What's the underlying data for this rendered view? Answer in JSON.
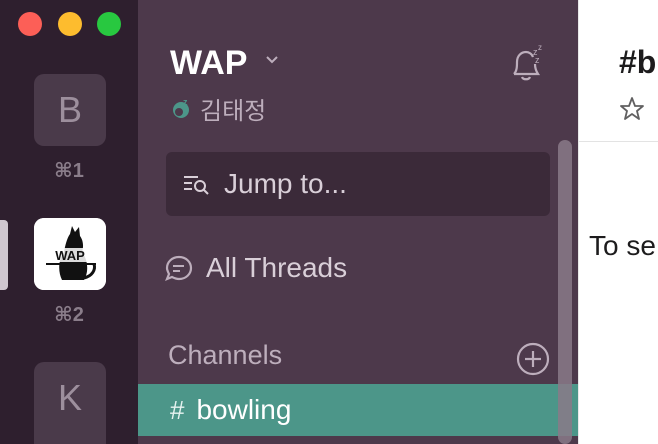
{
  "colors": {
    "rail_bg": "#2e1f2e",
    "sidebar_bg": "#4d394b",
    "active_channel_bg": "#4c9689",
    "jump_bg": "#3b2a39",
    "presence": "#4c9689"
  },
  "window_controls": [
    "close",
    "minimize",
    "zoom"
  ],
  "workspaces": [
    {
      "initial": "B",
      "shortcut": "⌘1"
    },
    {
      "logo_text": "WAP",
      "shortcut": "⌘2",
      "active": true
    },
    {
      "initial": "K"
    }
  ],
  "sidebar": {
    "team_name": "WAP",
    "user_name": "김태정",
    "jump_label": "Jump to...",
    "all_threads_label": "All Threads",
    "channels_header": "Channels",
    "channels": [
      {
        "name": "bowling",
        "active": true
      }
    ],
    "icons": [
      "chevron-down-icon",
      "snooze-bell-icon",
      "presence-icon",
      "jump-to-icon",
      "threads-icon",
      "add-channel-icon",
      "hash-icon"
    ]
  },
  "main": {
    "title": "#b",
    "message": "To se"
  }
}
